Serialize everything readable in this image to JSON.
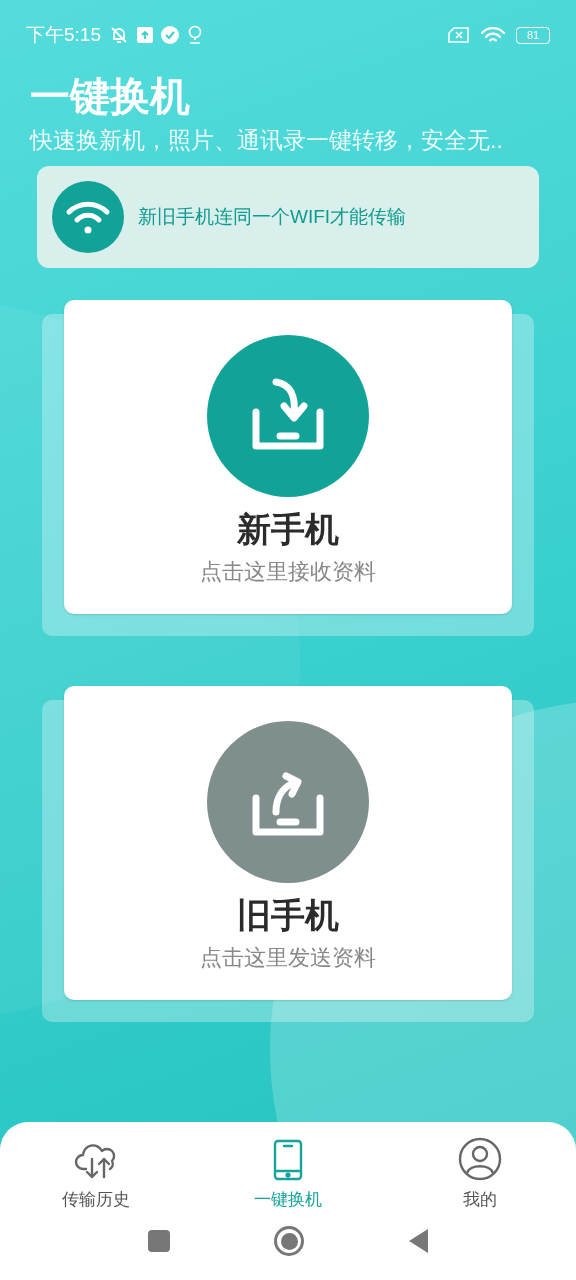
{
  "status_bar": {
    "time": "下午5:15",
    "battery": "81"
  },
  "header": {
    "title": "一键换机",
    "subtitle": "快速换新机，照片、通讯录一键转移，安全无.."
  },
  "notice": {
    "text": "新旧手机连同一个WIFI才能传输"
  },
  "cards": [
    {
      "kind": "receive",
      "title": "新手机",
      "subtitle": "点击这里接收资料"
    },
    {
      "kind": "send",
      "title": "旧手机",
      "subtitle": "点击这里发送资料"
    }
  ],
  "bottom_nav": [
    {
      "kind": "history",
      "label": "传输历史",
      "selected": false
    },
    {
      "kind": "phone",
      "label": "一键换机",
      "selected": true
    },
    {
      "kind": "profile",
      "label": "我的",
      "selected": false
    }
  ]
}
